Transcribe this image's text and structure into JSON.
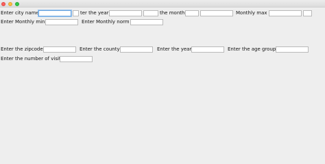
{
  "window": {
    "controls": [
      "close-icon",
      "minimize-icon",
      "maximize-icon"
    ]
  },
  "row1": {
    "city_label": "Enter city name",
    "city_value": "",
    "year_label": "ter the year",
    "year_value": "",
    "month_label": "the month",
    "month_value": "",
    "monthly_max_label": "Monthly max",
    "monthly_max_value": ""
  },
  "row2": {
    "monthly_min_label": "Enter Monthly min",
    "monthly_min_value": "",
    "monthly_norm_label": "Enter Monthly norm",
    "monthly_norm_value": ""
  },
  "row3": {
    "zipcode_label": "Enter the zipcode",
    "zipcode_value": "",
    "county_label": "Enter the county",
    "county_value": "",
    "year_label": "Enter the year",
    "year_value": "",
    "age_group_label": "Enter the age group",
    "age_group_value": ""
  },
  "row4": {
    "visits_label": "Enter the number of visit",
    "visits_value": ""
  },
  "colors": {
    "background": "#eeeeee",
    "focus": "#6aa4de"
  }
}
